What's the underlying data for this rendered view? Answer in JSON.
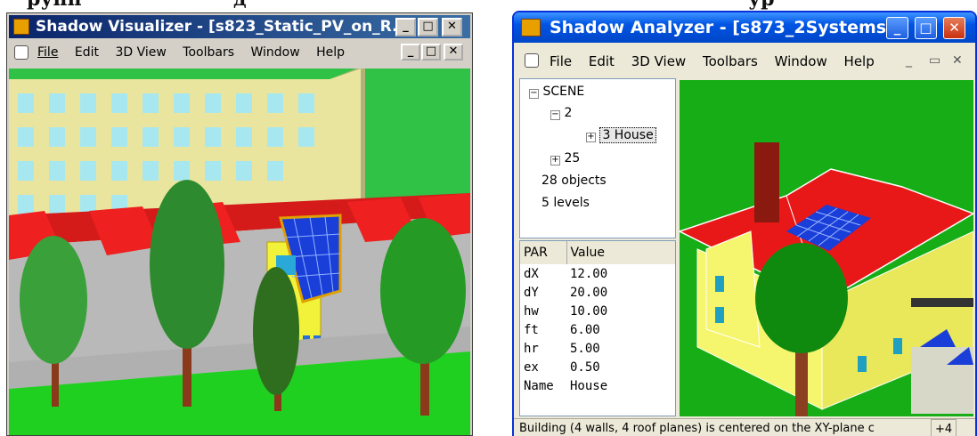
{
  "caption": {
    "left": "рупп",
    "mid": "д",
    "right": "ур"
  },
  "left_window": {
    "title": "Shadow Visualizer - [s823_Static_PV_on_R...",
    "menu": [
      "File",
      "Edit",
      "3D View",
      "Toolbars",
      "Window",
      "Help"
    ],
    "buttons": {
      "min": "_",
      "max": "□",
      "close": "✕"
    }
  },
  "right_window": {
    "title": "Shadow Analyzer - [s873_2Systems...",
    "menu": [
      "File",
      "Edit",
      "3D View",
      "Toolbars",
      "Window",
      "Help"
    ],
    "tree": {
      "root": "SCENE",
      "node2": "2",
      "house": "3 House",
      "node25": "25",
      "objects": "28 objects",
      "levels": "5 levels"
    },
    "table": {
      "headers": [
        "PAR",
        "Value"
      ],
      "rows": [
        [
          "dX",
          "12.00"
        ],
        [
          "dY",
          "20.00"
        ],
        [
          "hw",
          "10.00"
        ],
        [
          "ft",
          "6.00"
        ],
        [
          "hr",
          "5.00"
        ],
        [
          "ex",
          "0.50"
        ],
        [
          "Name",
          "House"
        ]
      ]
    },
    "status": "Building (4 walls, 4 roof planes) is centered on the XY-plane c",
    "status_zoom": "+4"
  }
}
